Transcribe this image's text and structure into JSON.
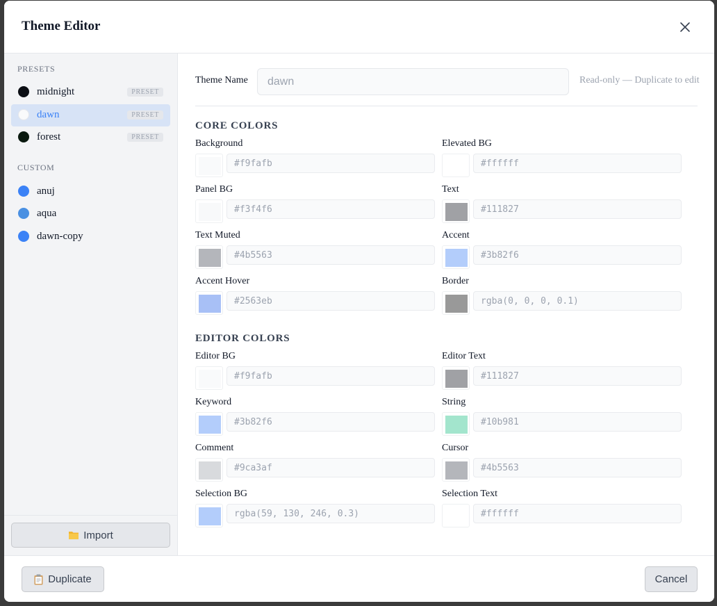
{
  "dialog": {
    "title": "Theme Editor"
  },
  "sidebar": {
    "presets_label": "PRESETS",
    "custom_label": "CUSTOM",
    "badge_text": "PRESET",
    "presets": [
      {
        "name": "midnight",
        "color": "#0b0e14"
      },
      {
        "name": "dawn",
        "color": "#f9fafb"
      },
      {
        "name": "forest",
        "color": "#0b1a10"
      }
    ],
    "custom": [
      {
        "name": "anuj",
        "color": "#3b82f6"
      },
      {
        "name": "aqua",
        "color": "#4a90e2"
      },
      {
        "name": "dawn-copy",
        "color": "#3b82f6"
      }
    ],
    "import_label": "Import",
    "import_icon": "folder-icon"
  },
  "main": {
    "theme_name_label": "Theme Name",
    "theme_name_value": "dawn",
    "readonly_note": "Read-only — Duplicate to edit",
    "core_title": "CORE COLORS",
    "core": [
      {
        "label": "Background",
        "value": "#f9fafb",
        "swatch": "#f9fafb"
      },
      {
        "label": "Elevated BG",
        "value": "#ffffff",
        "swatch": "#ffffff"
      },
      {
        "label": "Panel BG",
        "value": "#f3f4f6",
        "swatch": "#f8f9fa"
      },
      {
        "label": "Text",
        "value": "#111827",
        "swatch": "#a0a1a5"
      },
      {
        "label": "Text Muted",
        "value": "#4b5563",
        "swatch": "#b4b6bb"
      },
      {
        "label": "Accent",
        "value": "#3b82f6",
        "swatch": "#b3cdfb"
      },
      {
        "label": "Accent Hover",
        "value": "#2563eb",
        "swatch": "#a8c0f6"
      },
      {
        "label": "Border",
        "value": "rgba(0, 0, 0, 0.1)",
        "swatch": "#999999"
      }
    ],
    "editor_title": "EDITOR COLORS",
    "editor": [
      {
        "label": "Editor BG",
        "value": "#f9fafb",
        "swatch": "#f9fafb"
      },
      {
        "label": "Editor Text",
        "value": "#111827",
        "swatch": "#a0a1a5"
      },
      {
        "label": "Keyword",
        "value": "#3b82f6",
        "swatch": "#b3cdfb"
      },
      {
        "label": "String",
        "value": "#10b981",
        "swatch": "#a3e5cd"
      },
      {
        "label": "Comment",
        "value": "#9ca3af",
        "swatch": "#d8dadd"
      },
      {
        "label": "Cursor",
        "value": "#4b5563",
        "swatch": "#b4b6bb"
      },
      {
        "label": "Selection BG",
        "value": "rgba(59, 130, 246, 0.3)",
        "swatch": "#b3cdfb"
      },
      {
        "label": "Selection Text",
        "value": "#ffffff",
        "swatch": "#ffffff"
      }
    ]
  },
  "footer": {
    "duplicate_label": "Duplicate",
    "duplicate_icon": "clipboard-icon",
    "cancel_label": "Cancel"
  }
}
